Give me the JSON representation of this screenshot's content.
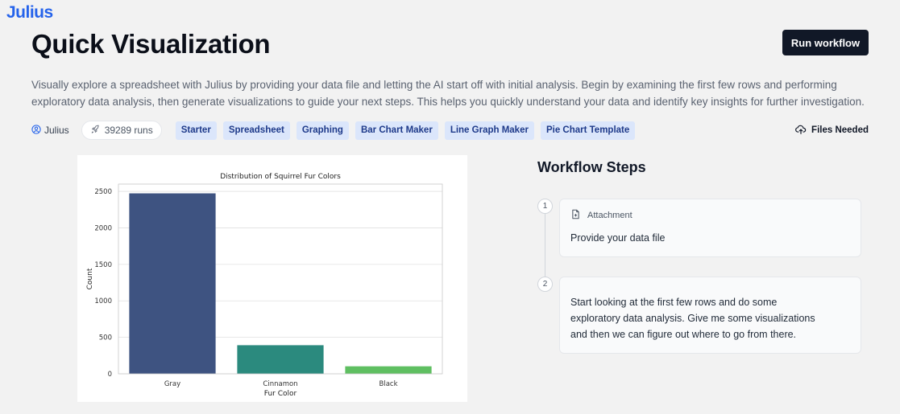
{
  "brand": {
    "logo": "Julius",
    "accent": "#2563eb"
  },
  "header": {
    "title": "Quick Visualization",
    "run_button": "Run workflow"
  },
  "description": "Visually explore a spreadsheet with Julius by providing your data file and letting the AI start off with initial analysis. Begin by examining the first few rows and performing exploratory data analysis, then generate visualizations to guide your next steps. This helps you quickly understand your data and identify key insights for further investigation.",
  "meta": {
    "author": "Julius",
    "author_icon": "user-circle-icon",
    "runs": "39289 runs",
    "runs_icon": "rocket-icon",
    "tags": [
      "Starter",
      "Spreadsheet",
      "Graphing",
      "Bar Chart Maker",
      "Line Graph Maker",
      "Pie Chart Template"
    ],
    "files_needed": "Files Needed",
    "files_icon": "cloud-upload-icon"
  },
  "chart_data": {
    "type": "bar",
    "title": "Distribution of Squirrel Fur Colors",
    "xlabel": "Fur Color",
    "ylabel": "Count",
    "categories": [
      "Gray",
      "Cinnamon",
      "Black"
    ],
    "values": [
      2473,
      392,
      103
    ],
    "colors": [
      "#3e5381",
      "#2b8a7e",
      "#5fbf61"
    ],
    "ylim": [
      0,
      2600
    ],
    "yticks": [
      0,
      500,
      1000,
      1500,
      2000,
      2500
    ],
    "grid": true
  },
  "workflow": {
    "title": "Workflow Steps",
    "steps": [
      {
        "number": "1",
        "type_label": "Attachment",
        "type_icon": "file-attachment-icon",
        "text": "Provide your data file"
      },
      {
        "number": "2",
        "lines": [
          "Start looking at the first few rows and do some",
          "exploratory data analysis. Give me some visualizations",
          "and then we can figure out where to go from there."
        ]
      }
    ]
  }
}
